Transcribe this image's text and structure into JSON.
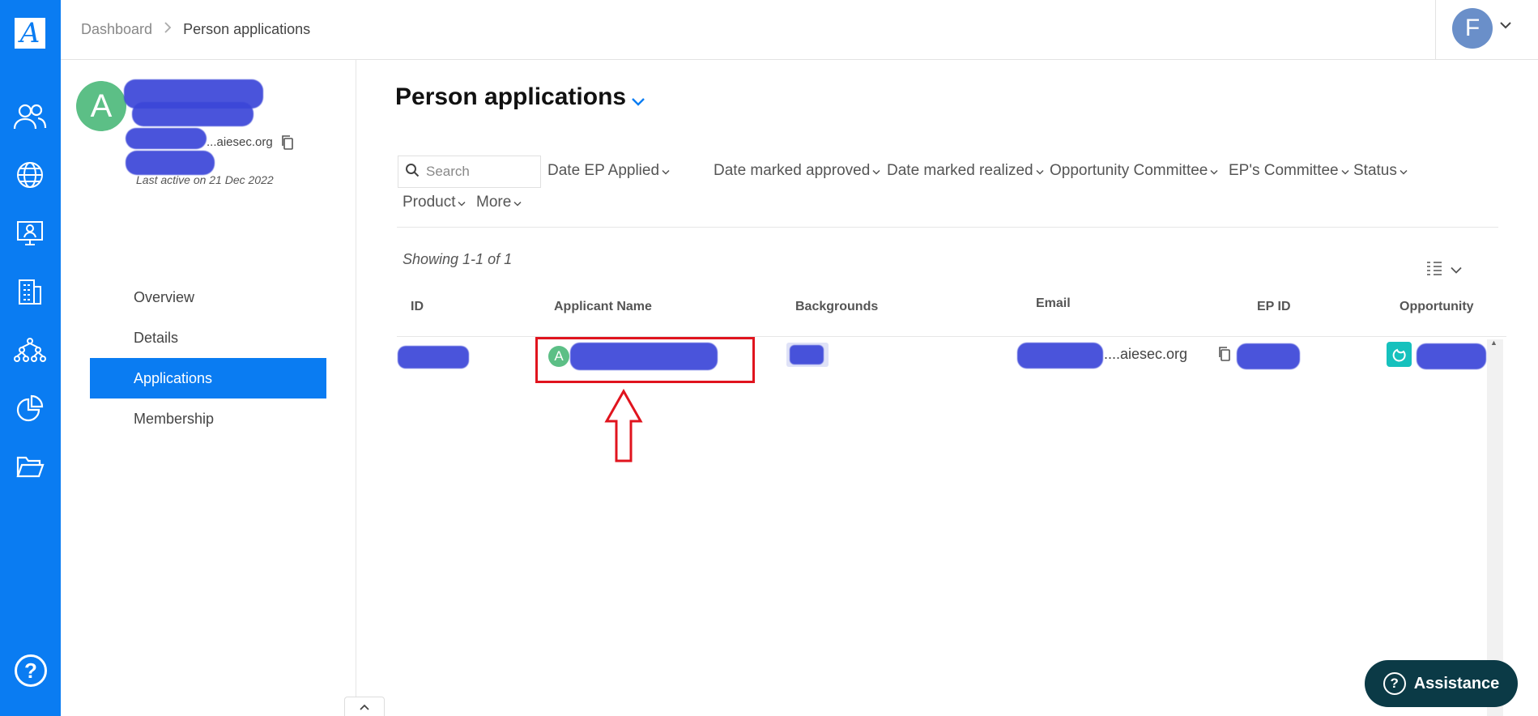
{
  "app": {
    "logo_letter": "A"
  },
  "rail": {
    "icons": [
      "people-icon",
      "globe-icon",
      "monitor-person-icon",
      "building-icon",
      "org-chart-icon",
      "pie-chart-icon",
      "folder-icon"
    ],
    "help_label": "?"
  },
  "breadcrumb": {
    "parent": "Dashboard",
    "separator": ">",
    "current": "Person applications"
  },
  "user": {
    "initial": "F"
  },
  "profile": {
    "avatar_initial": "A",
    "email_suffix": "...aiesec.org",
    "last_active": "Last active on 21 Dec 2022",
    "nav": [
      {
        "label": "Overview",
        "active": false
      },
      {
        "label": "Details",
        "active": false
      },
      {
        "label": "Applications",
        "active": true
      },
      {
        "label": "Membership",
        "active": false
      }
    ]
  },
  "main": {
    "title": "Person applications",
    "search_placeholder": "Search",
    "filters": [
      "Date EP Applied",
      "Date marked approved",
      "Date marked realized",
      "Opportunity Committee",
      "EP's Committee",
      "Status",
      "Product",
      "More"
    ],
    "showing": "Showing  1-1 of 1",
    "columns": [
      "ID",
      "Applicant Name",
      "Backgrounds",
      "Email",
      "EP ID",
      "Opportunity"
    ],
    "row": {
      "applicant_initial": "A",
      "email_suffix": "....aiesec.org"
    }
  },
  "assistance": {
    "label": "Assistance",
    "icon": "?"
  },
  "colors": {
    "brand_blue": "#0a7cf2",
    "avatar_green": "#5cbf86",
    "highlight_red": "#e0141e",
    "assist_bg": "#0b3a46",
    "redaction": "#3b46d8"
  }
}
